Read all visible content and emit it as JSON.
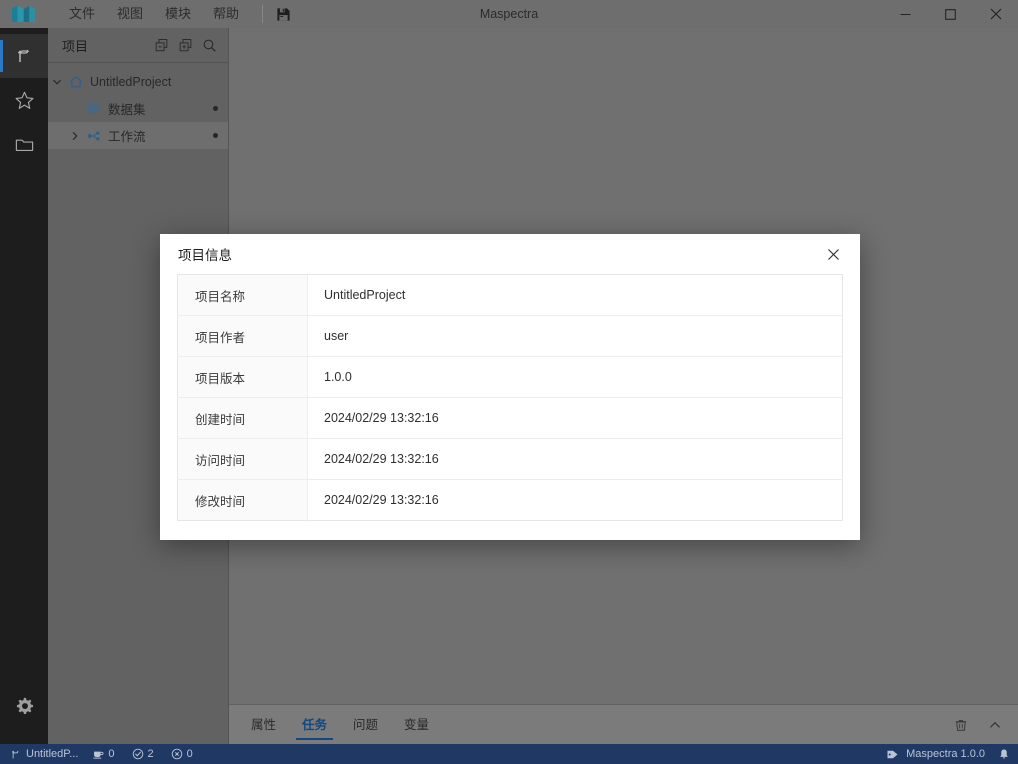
{
  "app": {
    "title": "Maspectra",
    "logo": "maspectra-logo",
    "accent": "#1f3864",
    "tab_active_color": "#16508f"
  },
  "titlebar": {
    "menus": [
      {
        "label": "文件",
        "name": "menu-file"
      },
      {
        "label": "视图",
        "name": "menu-view"
      },
      {
        "label": "模块",
        "name": "menu-module"
      },
      {
        "label": "帮助",
        "name": "menu-help"
      }
    ],
    "tools": [
      {
        "icon": "save-icon",
        "name": "save-button"
      }
    ],
    "window_controls": [
      {
        "icon": "minimize-icon",
        "name": "minimize-button"
      },
      {
        "icon": "maximize-icon",
        "name": "maximize-button"
      },
      {
        "icon": "close-icon",
        "name": "close-button"
      }
    ]
  },
  "activity_bar": {
    "items": [
      {
        "icon": "workflow-branch-icon",
        "name": "activity-item-project",
        "active": true
      },
      {
        "icon": "star-icon",
        "name": "activity-item-favorites",
        "active": false
      },
      {
        "icon": "folder-icon",
        "name": "activity-item-files",
        "active": false
      }
    ],
    "bottom": [
      {
        "icon": "gear-icon",
        "name": "activity-item-settings"
      }
    ]
  },
  "project_panel": {
    "title": "项目",
    "actions": [
      {
        "icon": "collapse-all-icon",
        "name": "collapse-all-button"
      },
      {
        "icon": "expand-all-icon",
        "name": "expand-all-button"
      },
      {
        "icon": "search-icon",
        "name": "search-button"
      }
    ],
    "tree": [
      {
        "label": "UntitledProject",
        "icon": "home-icon",
        "twisty": "chevron-down",
        "depth": 0,
        "dot": false,
        "selected": false
      },
      {
        "label": "数据集",
        "icon": "dataset-table-icon",
        "twisty": "none",
        "depth": 1,
        "dot": true,
        "selected": false
      },
      {
        "label": "工作流",
        "icon": "workflow-nodes-icon",
        "twisty": "chevron-right",
        "depth": 1,
        "dot": true,
        "selected": true
      }
    ]
  },
  "bottom_panel": {
    "tabs": [
      {
        "label": "属性",
        "name": "tab-properties",
        "active": false
      },
      {
        "label": "任务",
        "name": "tab-tasks",
        "active": true
      },
      {
        "label": "问题",
        "name": "tab-problems",
        "active": false
      },
      {
        "label": "变量",
        "name": "tab-variables",
        "active": false
      }
    ],
    "actions": [
      {
        "icon": "trash-icon",
        "name": "clear-button"
      },
      {
        "icon": "chevron-up-icon",
        "name": "collapse-panel-button"
      }
    ]
  },
  "statusbar": {
    "project_icon": "workflow-branch-icon",
    "project_name": "UntitledP...",
    "metrics": [
      {
        "icon": "cup-icon",
        "name": "running-count",
        "value": "0"
      },
      {
        "icon": "check-circle-icon",
        "name": "success-count",
        "value": "2"
      },
      {
        "icon": "x-circle-icon",
        "name": "error-count",
        "value": "0"
      }
    ],
    "version_icon": "tag-icon",
    "version": "Maspectra 1.0.0",
    "notification_icon": "bell-icon"
  },
  "dialog": {
    "title": "项目信息",
    "close_icon": "close-icon",
    "rows": [
      {
        "key": "项目名称",
        "value": "UntitledProject"
      },
      {
        "key": "项目作者",
        "value": "user"
      },
      {
        "key": "项目版本",
        "value": "1.0.0"
      },
      {
        "key": "创建时间",
        "value": "2024/02/29 13:32:16"
      },
      {
        "key": "访问时间",
        "value": "2024/02/29 13:32:16"
      },
      {
        "key": "修改时间",
        "value": "2024/02/29 13:32:16"
      }
    ]
  }
}
